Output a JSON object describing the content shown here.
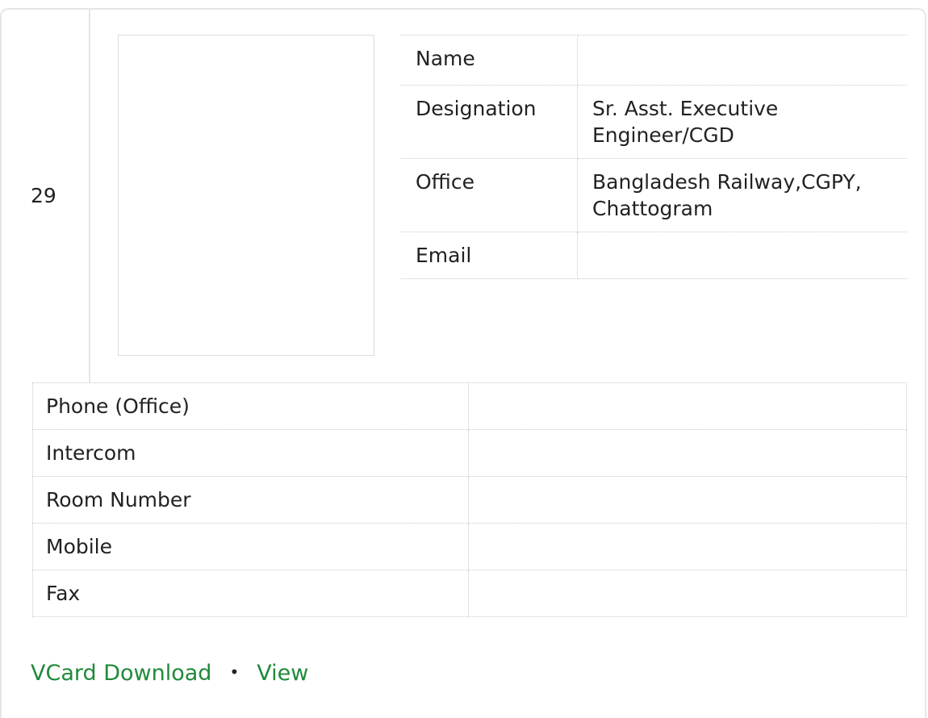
{
  "entry": {
    "serial": "29"
  },
  "info_table": {
    "rows": [
      {
        "label": "Name",
        "value": ""
      },
      {
        "label": "Designation",
        "value": "Sr. Asst. Executive Engineer/CGD"
      },
      {
        "label": "Office",
        "value": "Bangladesh Railway,CGPY, Chattogram"
      },
      {
        "label": "Email",
        "value": ""
      }
    ]
  },
  "contact_table": {
    "rows": [
      {
        "label": "Phone (Office)",
        "value": ""
      },
      {
        "label": "Intercom",
        "value": ""
      },
      {
        "label": "Room Number",
        "value": ""
      },
      {
        "label": "Mobile",
        "value": ""
      },
      {
        "label": "Fax",
        "value": ""
      }
    ]
  },
  "links": {
    "vcard_download": "VCard Download",
    "separator": "•",
    "view": "View"
  },
  "colors": {
    "link": "#1f8a3a",
    "border": "#c8c8c8"
  }
}
